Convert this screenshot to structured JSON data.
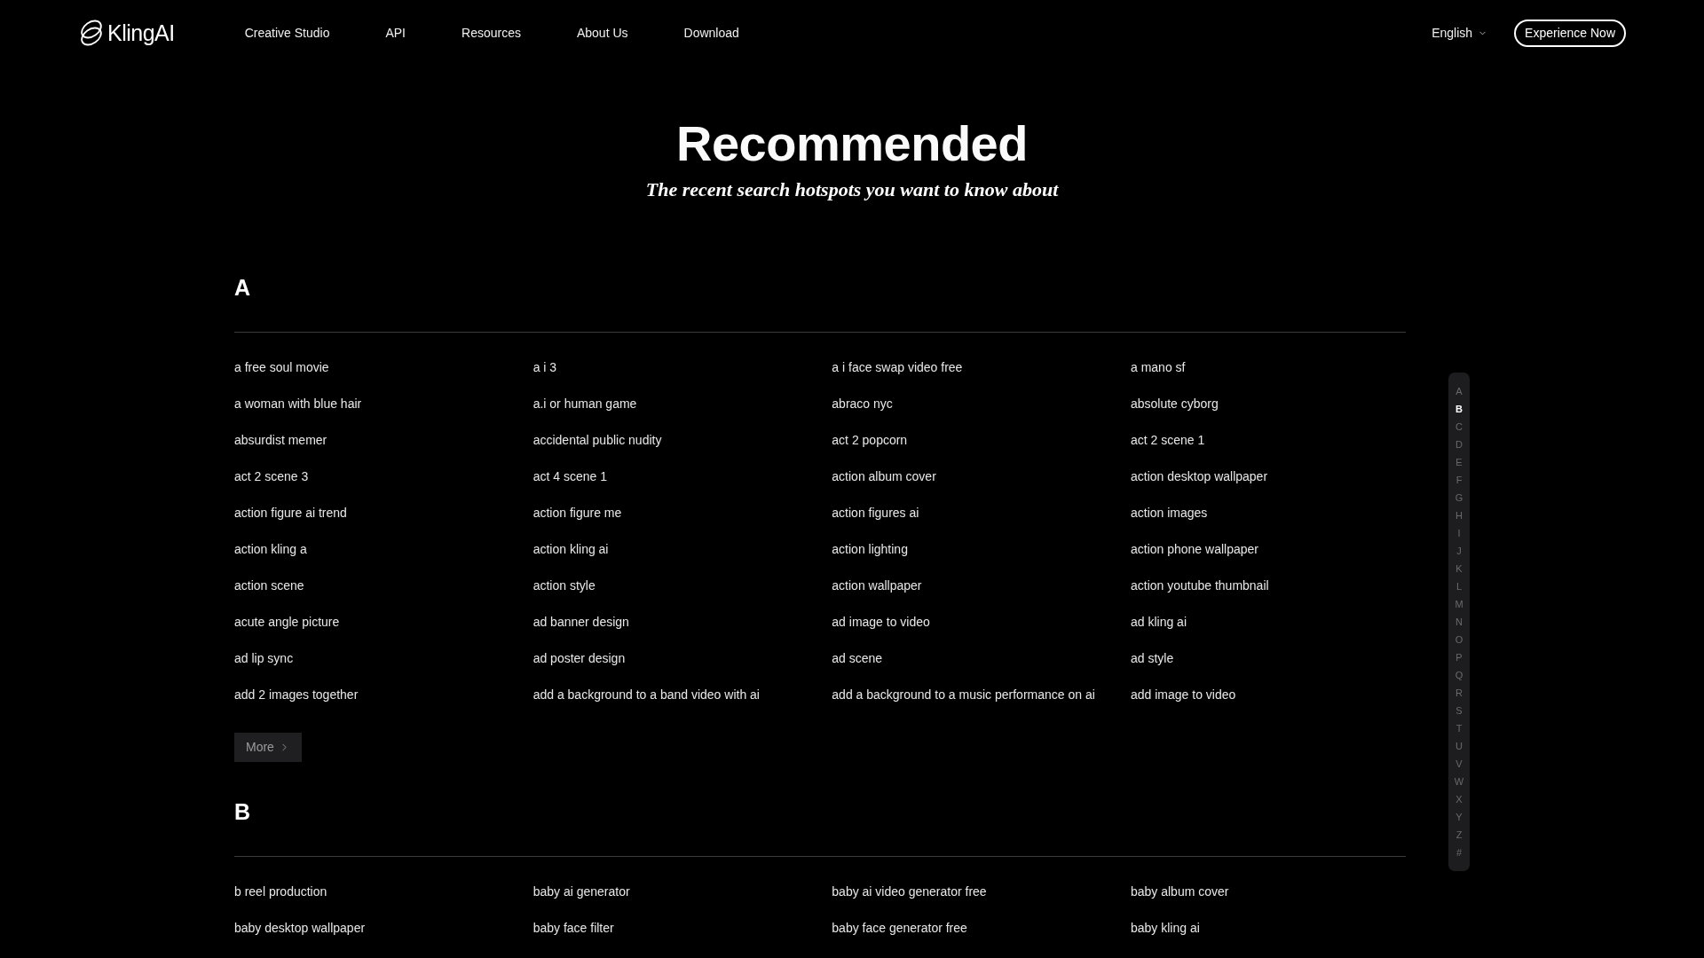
{
  "header": {
    "logo": "KlingAI",
    "nav": [
      "Creative Studio",
      "API",
      "Resources",
      "About Us",
      "Download"
    ],
    "language": "English",
    "cta": "Experience Now"
  },
  "hero": {
    "title": "Recommended",
    "subtitle": "The recent search hotspots you want to know about"
  },
  "sections": [
    {
      "letter": "A",
      "items": [
        "a free soul movie",
        "a i 3",
        "a i face swap video free",
        "a mano sf",
        "a woman with blue hair",
        "a.i or human game",
        "abraco nyc",
        "absolute cyborg",
        "absurdist memer",
        "accidental public nudity",
        "act 2 popcorn",
        "act 2 scene 1",
        "act 2 scene 3",
        "act 4 scene 1",
        "action album cover",
        "action desktop wallpaper",
        "action figure ai trend",
        "action figure me",
        "action figures ai",
        "action images",
        "action kling a",
        "action kling ai",
        "action lighting",
        "action phone wallpaper",
        "action scene",
        "action style",
        "action wallpaper",
        "action youtube thumbnail",
        "acute angle picture",
        "ad banner design",
        "ad image to video",
        "ad kling ai",
        "ad lip sync",
        "ad poster design",
        "ad scene",
        "ad style",
        "add 2 images together",
        "add a background to a band video with ai",
        "add a background to a music performance on ai",
        "add image to video"
      ],
      "more": "More"
    },
    {
      "letter": "B",
      "items": [
        "b reel production",
        "baby ai generator",
        "baby ai video generator free",
        "baby album cover",
        "baby desktop wallpaper",
        "baby face filter",
        "baby face generator free",
        "baby kling ai"
      ]
    }
  ],
  "index_bar": [
    {
      "label": "A",
      "selected": false
    },
    {
      "label": "B",
      "selected": true
    },
    {
      "label": "C",
      "selected": false
    },
    {
      "label": "D",
      "selected": false
    },
    {
      "label": "E",
      "selected": false
    },
    {
      "label": "F",
      "selected": false
    },
    {
      "label": "G",
      "selected": false
    },
    {
      "label": "H",
      "selected": false
    },
    {
      "label": "I",
      "selected": false
    },
    {
      "label": "J",
      "selected": false
    },
    {
      "label": "K",
      "selected": false
    },
    {
      "label": "L",
      "selected": false
    },
    {
      "label": "M",
      "selected": false
    },
    {
      "label": "N",
      "selected": false
    },
    {
      "label": "O",
      "selected": false
    },
    {
      "label": "P",
      "selected": false
    },
    {
      "label": "Q",
      "selected": false
    },
    {
      "label": "R",
      "selected": false
    },
    {
      "label": "S",
      "selected": false
    },
    {
      "label": "T",
      "selected": false
    },
    {
      "label": "U",
      "selected": false
    },
    {
      "label": "V",
      "selected": false
    },
    {
      "label": "W",
      "selected": false
    },
    {
      "label": "X",
      "selected": false
    },
    {
      "label": "Y",
      "selected": false
    },
    {
      "label": "Z",
      "selected": false
    },
    {
      "label": "#",
      "selected": false
    }
  ]
}
